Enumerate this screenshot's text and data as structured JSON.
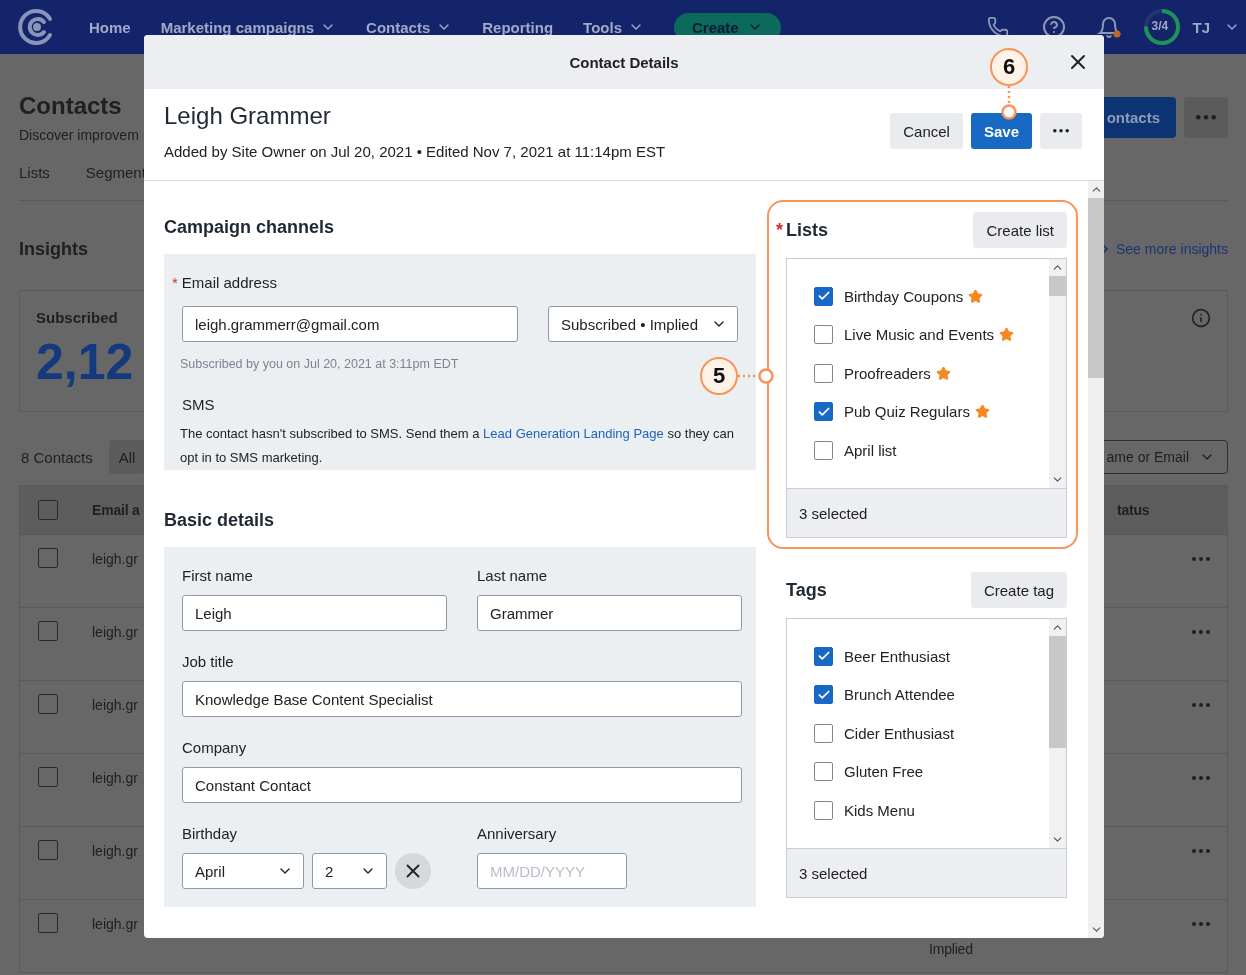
{
  "nav": {
    "items": [
      {
        "label": "Home",
        "dropdown": false
      },
      {
        "label": "Marketing campaigns",
        "dropdown": true
      },
      {
        "label": "Contacts",
        "dropdown": true
      },
      {
        "label": "Reporting",
        "dropdown": false
      },
      {
        "label": "Tools",
        "dropdown": true
      }
    ],
    "create_button": "Create",
    "progress": {
      "label": "3/4",
      "level": 0.75
    },
    "user": "TJ"
  },
  "page": {
    "title": "Contacts",
    "subtitle": "Discover improvem",
    "primary_button": "ontacts",
    "tabs": [
      "Lists",
      "Segment"
    ],
    "insights": {
      "title": "Insights",
      "link": "See more insights"
    },
    "card": {
      "label": "Subscribed",
      "value": "2,12"
    },
    "contacts_count": "8 Contacts",
    "filter_button": "All",
    "search_dropdown": "ame or Email",
    "table": {
      "columns": [
        "Email a",
        "tatus"
      ],
      "header_checked": false,
      "rows": [
        {
          "email": "leigh.gr",
          "checked": false
        },
        {
          "email": "leigh.gr",
          "checked": false
        },
        {
          "email": "leigh.gr",
          "checked": false
        },
        {
          "email": "leigh.gr",
          "checked": false
        },
        {
          "email": "leigh.gr",
          "checked": false
        },
        {
          "email": "leigh.gr",
          "checked": false,
          "column_3": "Implied"
        }
      ]
    }
  },
  "modal": {
    "title": "Contact Details",
    "name": "Leigh Grammer",
    "meta": "Added by Site Owner on Jul 20, 2021 • Edited Nov 7, 2021 at 11:14pm EST",
    "cancel_button": "Cancel",
    "save_button": "Save",
    "save_callout": "6",
    "campaign": {
      "title": "Campaign channels",
      "email_label": "Email address",
      "required_mark": "*",
      "email": "leigh.grammerr@gmail.com",
      "status": "Subscribed • Implied",
      "note": "Subscribed by you on Jul 20, 2021 at 3:11pm EDT",
      "sms_title": "SMS",
      "sms_before": "The contact hasn't subscribed to SMS. Send them a ",
      "sms_link": "Lead Generation Landing Page",
      "sms_after": " so they can opt in to SMS marketing."
    },
    "basic": {
      "title": "Basic details",
      "name_fields": [
        {
          "label": "First name",
          "value": "Leigh"
        },
        {
          "label": "Last name",
          "value": "Grammer"
        }
      ],
      "fields": [
        {
          "label": "Job title",
          "value": "Knowledge Base Content Specialist"
        },
        {
          "label": "Company",
          "value": "Constant Contact"
        }
      ],
      "birthday": {
        "label": "Birthday",
        "month": "April",
        "day": "2"
      },
      "anniversary": {
        "label": "Anniversary",
        "placeholder": "MM/DD/YYYY"
      }
    },
    "lists": {
      "title": "Lists",
      "required_mark": "*",
      "button": "Create list",
      "footer": "3 selected",
      "callout": "5",
      "items": [
        {
          "label": "Birthday Coupons",
          "checked": true,
          "starred": true
        },
        {
          "label": "Live Music and Events",
          "checked": false,
          "starred": true
        },
        {
          "label": "Proofreaders",
          "checked": false,
          "starred": true
        },
        {
          "label": "Pub Quiz Regulars",
          "checked": true,
          "starred": true
        },
        {
          "label": "April list",
          "checked": false,
          "starred": false
        }
      ]
    },
    "tags": {
      "title": "Tags",
      "button": "Create tag",
      "footer": "3 selected",
      "items": [
        {
          "label": "Beer Enthusiast",
          "checked": true,
          "starred": false
        },
        {
          "label": "Brunch Attendee",
          "checked": true,
          "starred": false
        },
        {
          "label": "Cider Enthusiast",
          "checked": false,
          "starred": false
        },
        {
          "label": "Gluten Free",
          "checked": false,
          "starred": false
        },
        {
          "label": "Kids Menu",
          "checked": false,
          "starred": false
        }
      ]
    }
  }
}
